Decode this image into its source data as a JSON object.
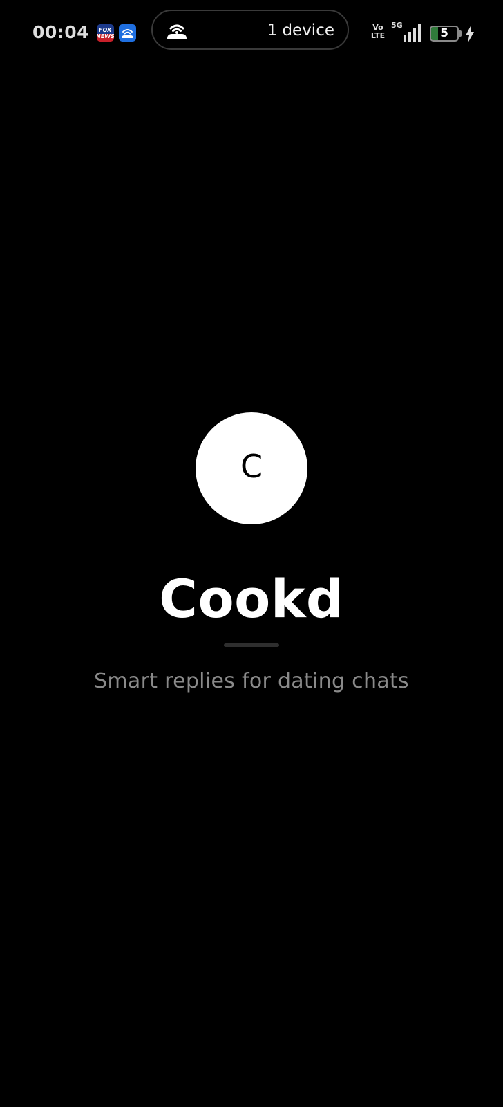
{
  "status_bar": {
    "time": "00:04",
    "notification_icons": [
      {
        "name": "fox-news-icon",
        "text_line1": "FOX",
        "text_line2": "NEWS"
      },
      {
        "name": "hotspot-app-icon"
      }
    ],
    "hotspot": {
      "icon": "hotspot-icon",
      "label": "1 device"
    },
    "volte_line1": "Vo",
    "volte_line2": "LTE",
    "network_type": "5G",
    "battery_level": "5",
    "battery_fraction": 0.05,
    "charging": true,
    "colors": {
      "battery_fill": "#2f7a3a",
      "hotspot_app_bg": "#1f6fe0"
    }
  },
  "splash": {
    "logo_letter": "C",
    "app_name": "Cookd",
    "tagline": "Smart replies for dating chats"
  },
  "colors": {
    "background": "#000000",
    "logo_circle": "#ffffff",
    "title": "#ffffff",
    "tagline": "#8a8a8a"
  }
}
